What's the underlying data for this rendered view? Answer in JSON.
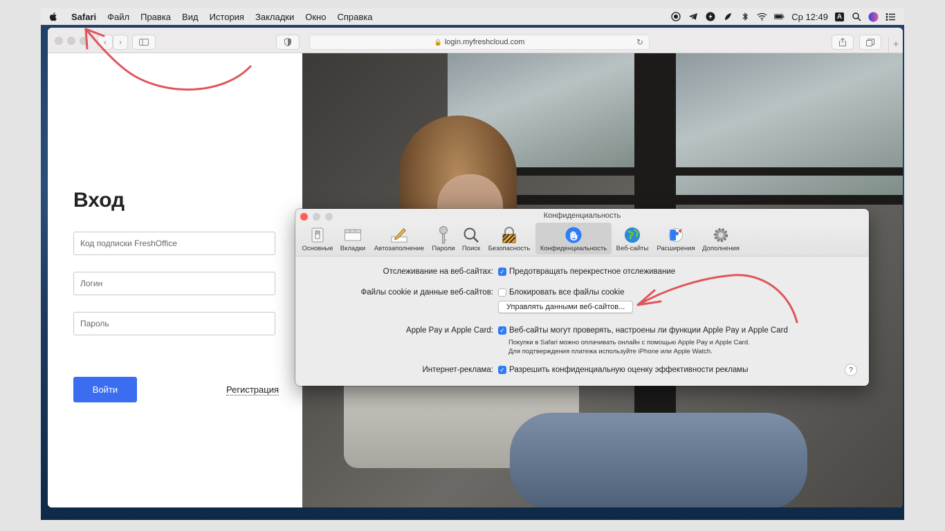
{
  "menubar": {
    "app": "Safari",
    "items": [
      "Файл",
      "Правка",
      "Вид",
      "История",
      "Закладки",
      "Окно",
      "Справка"
    ],
    "clock": "Ср 12:49",
    "input_source": "A",
    "status_icons": [
      "record-icon",
      "telegram-icon",
      "bolt-icon",
      "leaf-icon",
      "bluetooth-icon",
      "wifi-icon",
      "battery-icon",
      "input-source-icon",
      "spotlight-icon",
      "siri-icon",
      "control-center-icon"
    ]
  },
  "browser": {
    "url": "login.myfreshcloud.com"
  },
  "login": {
    "title": "Вход",
    "subscription_placeholder": "Код подписки FreshOffice",
    "login_placeholder": "Логин",
    "password_placeholder": "Пароль",
    "submit_label": "Войти",
    "register_label": "Регистрация"
  },
  "prefs": {
    "title": "Конфиденциальность",
    "tabs": [
      {
        "label": "Основные",
        "icon": "switch-icon"
      },
      {
        "label": "Вкладки",
        "icon": "tabs-icon"
      },
      {
        "label": "Автозаполнение",
        "icon": "pencil-icon"
      },
      {
        "label": "Пароли",
        "icon": "key-icon"
      },
      {
        "label": "Поиск",
        "icon": "magnifier-icon"
      },
      {
        "label": "Безопасность",
        "icon": "lock-icon"
      },
      {
        "label": "Конфиденциальность",
        "icon": "hand-icon"
      },
      {
        "label": "Веб-сайты",
        "icon": "globe-icon"
      },
      {
        "label": "Расширения",
        "icon": "puzzle-icon"
      },
      {
        "label": "Дополнения",
        "icon": "gear-icon"
      }
    ],
    "active_tab": "Конфиденциальность",
    "tracking_label": "Отслеживание на веб-сайтах:",
    "tracking_option": "Предотвращать перекрестное отслеживание",
    "tracking_checked": true,
    "cookies_label": "Файлы cookie и данные веб-сайтов:",
    "cookies_option": "Блокировать все файлы cookie",
    "cookies_checked": false,
    "manage_button": "Управлять данными веб-сайтов...",
    "applepay_label": "Apple Pay и Apple Card:",
    "applepay_option": "Веб-сайты могут проверять, настроены ли функции Apple Pay и Apple Card",
    "applepay_checked": true,
    "applepay_note_1": "Покупки в Safari можно оплачивать онлайн с помощью Apple Pay и Apple Card.",
    "applepay_note_2": "Для подтверждения платежа используйте iPhone или Apple Watch.",
    "ads_label": "Интернет-реклама:",
    "ads_option": "Разрешить конфиденциальную оценку эффективности рекламы",
    "ads_checked": true,
    "help": "?"
  },
  "colors": {
    "accent": "#2f7cf6",
    "login_button": "#3a6df0",
    "annotation_arrow": "#e0545a"
  }
}
